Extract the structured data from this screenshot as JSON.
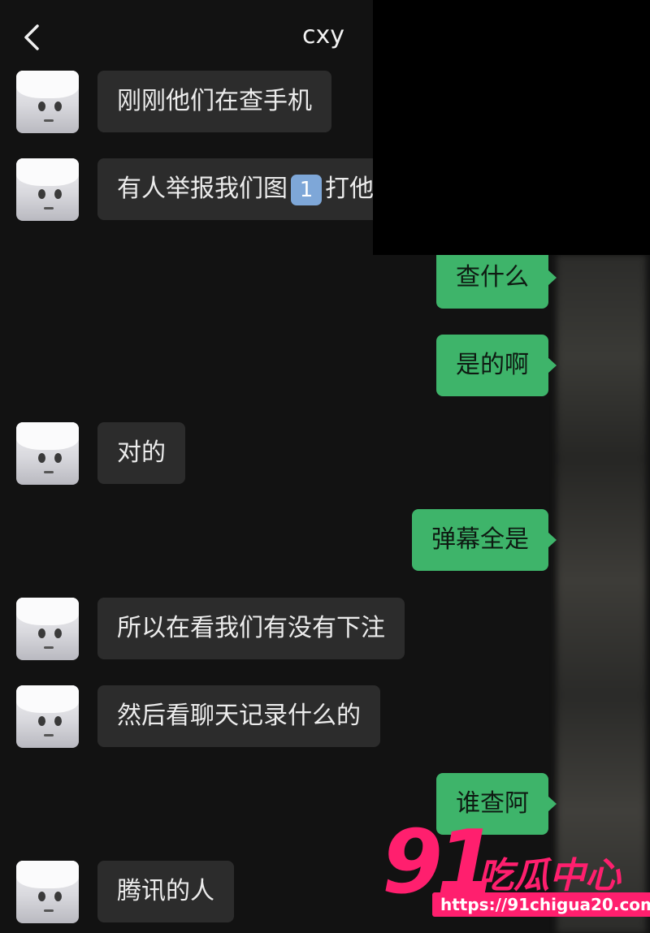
{
  "header": {
    "title": "cxy",
    "back_icon": "chevron-left-icon"
  },
  "messages": [
    {
      "side": "in",
      "text": "刚刚他们在查手机"
    },
    {
      "side": "in",
      "text_before": "有人举报我们图",
      "emoji": "1",
      "text_after": "打他"
    },
    {
      "side": "out",
      "text": "查什么"
    },
    {
      "side": "out",
      "text": "是的啊"
    },
    {
      "side": "in",
      "text": "对的"
    },
    {
      "side": "out",
      "text": "弹幕全是"
    },
    {
      "side": "in",
      "text": "所以在看我们有没有下注"
    },
    {
      "side": "in",
      "text": "然后看聊天记录什么的"
    },
    {
      "side": "out",
      "text": "谁查阿"
    },
    {
      "side": "in",
      "text": "腾讯的人"
    }
  ],
  "watermark": {
    "number": "91",
    "text": "吃瓜中心",
    "url": "https://91chigua20.com"
  },
  "colors": {
    "background": "#121212",
    "bubble_in": "#2c2c2c",
    "bubble_out": "#3eb46a",
    "watermark": "#ff1f6e"
  }
}
